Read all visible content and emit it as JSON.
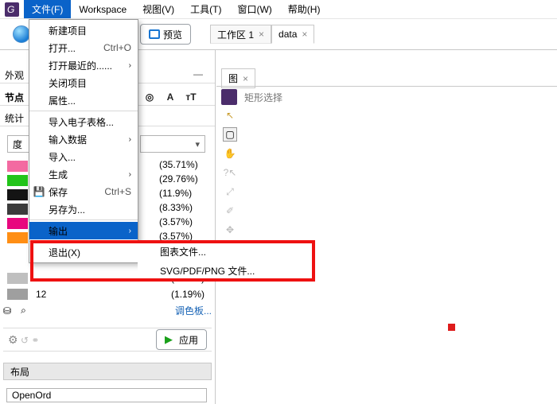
{
  "menubar": {
    "file": "文件(F)",
    "workspace": "Workspace",
    "view": "视图(V)",
    "tools": "工具(T)",
    "window": "窗口(W)",
    "help": "帮助(H)"
  },
  "toolbar": {
    "preview": "预览"
  },
  "top_tabs": {
    "workspace1": "工作区 1",
    "data": "data",
    "close": "×"
  },
  "sidebar": {
    "appearance": "外观",
    "nodes_heading": "节点",
    "stats": "统计",
    "degree": "度",
    "palette": "调色板...",
    "apply": "应用",
    "layout": "布局",
    "layout_algo": "OpenOrd",
    "minimize": "—"
  },
  "rows": [
    {
      "color": "#f36aa1",
      "pct": "(35.71%)"
    },
    {
      "color": "#22c41a",
      "pct": "(29.76%)"
    },
    {
      "color": "#141414",
      "pct": "(11.9%)"
    },
    {
      "color": "#3b3b3b",
      "pct": "(8.33%)"
    },
    {
      "color": "#e8077e",
      "pct": "(3.57%)"
    },
    {
      "color": "#ff8e14",
      "pct": "(3.57%)"
    }
  ],
  "rows2": [
    {
      "color": "#bfbfbf",
      "count": "",
      "pct": "(1.19%)"
    },
    {
      "color": "#9f9f9f",
      "count": "12",
      "pct": "(1.19%)"
    }
  ],
  "file_menu": {
    "new_project": "新建项目",
    "open": "打开...",
    "open_sc": "Ctrl+O",
    "open_recent": "打开最近的......",
    "close_project": "关闭项目",
    "properties": "属性...",
    "import_spreadsheet": "导入电子表格...",
    "import_data": "输入数据",
    "import": "导入...",
    "generate": "生成",
    "save": "保存",
    "save_sc": "Ctrl+S",
    "save_as": "另存为...",
    "export": "输出",
    "exit": "退出(X)"
  },
  "export_sub": {
    "chart_file": "图表文件...",
    "svg": "SVG/PDF/PNG 文件..."
  },
  "right": {
    "tab": "图",
    "close": "×",
    "rect_select": "矩形选择"
  },
  "icons": {
    "save_glyph": "💾",
    "arrow_right": "›",
    "disc": "◎",
    "letter_a": "A",
    "tt": "тT",
    "cursor": "↖",
    "marquee": "▢",
    "hand": "✋",
    "help_cursor": "?↖",
    "size": "⤢",
    "brush": "✐",
    "pan": "✥",
    "node": "◯",
    "db": "⛁",
    "funnel": "⌕",
    "reset": "↺",
    "link": "⚭",
    "gear": "⚙",
    "play": "▶"
  }
}
